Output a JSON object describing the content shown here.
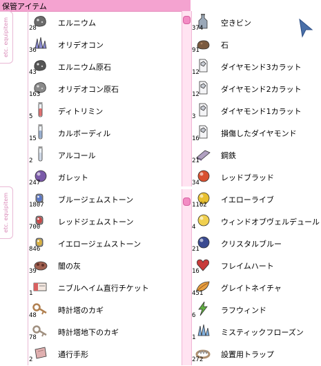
{
  "window": {
    "title": "保管アイテム"
  },
  "tabs": [
    {
      "label": "etc. equipitem"
    },
    {
      "label": "etc. equipitem"
    }
  ],
  "left_items": [
    {
      "name": "エルニウム",
      "qty": "28",
      "icon": "gray-ore",
      "color": "#6b6b6b"
    },
    {
      "name": "オリデオコン",
      "qty": "36",
      "icon": "crystal",
      "color": "#8a8ad0"
    },
    {
      "name": "エルニウム原石",
      "qty": "43",
      "icon": "gray-ore",
      "color": "#555555"
    },
    {
      "name": "オリデオコン原石",
      "qty": "163",
      "icon": "gray-ore",
      "color": "#8a8a8a"
    },
    {
      "name": "ディトリミン",
      "qty": "5",
      "icon": "vial",
      "color": "#e07070"
    },
    {
      "name": "カルボーディル",
      "qty": "15",
      "icon": "vial",
      "color": "#9ab0d0"
    },
    {
      "name": "アルコール",
      "qty": "2",
      "icon": "vial",
      "color": "#cfd8e6"
    },
    {
      "name": "ガレット",
      "qty": "247",
      "icon": "orb",
      "color": "#7a5aa8"
    },
    {
      "name": "ブルージェムストーン",
      "qty": "1807",
      "icon": "gem",
      "color": "#5b78c8"
    },
    {
      "name": "レッドジェムストーン",
      "qty": "700",
      "icon": "gem",
      "color": "#c84a4a"
    },
    {
      "name": "イエロージェムストーン",
      "qty": "846",
      "icon": "gem",
      "color": "#d8b040"
    },
    {
      "name": "闇の灰",
      "qty": "39",
      "icon": "ash",
      "color": "#a06050"
    },
    {
      "name": "ニブルヘイム直行チケット",
      "qty": "1",
      "icon": "ticket",
      "color": "#d86060"
    },
    {
      "name": "時計塔のカギ",
      "qty": "48",
      "icon": "key",
      "color": "#b08050"
    },
    {
      "name": "時計塔地下のカギ",
      "qty": "78",
      "icon": "key",
      "color": "#a09080"
    },
    {
      "name": "通行手形",
      "qty": "2",
      "icon": "paper",
      "color": "#e0b0b0"
    }
  ],
  "right_items": [
    {
      "name": "空きビン",
      "qty": "374",
      "icon": "bottle",
      "color": "#9aa8b8"
    },
    {
      "name": "石",
      "qty": "91",
      "icon": "stone",
      "color": "#7a5a40"
    },
    {
      "name": "ダイヤモンド3カラット",
      "qty": "12",
      "icon": "diamond",
      "color": "#c8ccd4"
    },
    {
      "name": "ダイヤモンド2カラット",
      "qty": "12",
      "icon": "diamond",
      "color": "#c8ccd4"
    },
    {
      "name": "ダイヤモンド1カラット",
      "qty": "3",
      "icon": "diamond",
      "color": "#c8ccd4"
    },
    {
      "name": "損傷したダイヤモンド",
      "qty": "16",
      "icon": "diamond",
      "color": "#c0c4cc"
    },
    {
      "name": "鋼鉄",
      "qty": "21",
      "icon": "steel",
      "color": "#b0a0c0"
    },
    {
      "name": "レッドブラッド",
      "qty": "34",
      "icon": "orb",
      "color": "#d85030"
    },
    {
      "name": "イエローライブ",
      "qty": "1162",
      "icon": "orb",
      "color": "#e8c030"
    },
    {
      "name": "ウィンドオブヴェルデュール",
      "qty": "4",
      "icon": "orb",
      "color": "#f0d050"
    },
    {
      "name": "クリスタルブルー",
      "qty": "21",
      "icon": "orb",
      "color": "#3a4a90"
    },
    {
      "name": "フレイムハート",
      "qty": "16",
      "icon": "heart",
      "color": "#c83a3a"
    },
    {
      "name": "グレイトネイチャ",
      "qty": "451",
      "icon": "leaf",
      "color": "#e8a040"
    },
    {
      "name": "ラフウィンド",
      "qty": "6",
      "icon": "bolt",
      "color": "#60b040"
    },
    {
      "name": "ミスティックフローズン",
      "qty": "1",
      "icon": "crystal",
      "color": "#80b0e0"
    },
    {
      "name": "設置用トラップ",
      "qty": "272",
      "icon": "trap",
      "color": "#b09070"
    }
  ]
}
